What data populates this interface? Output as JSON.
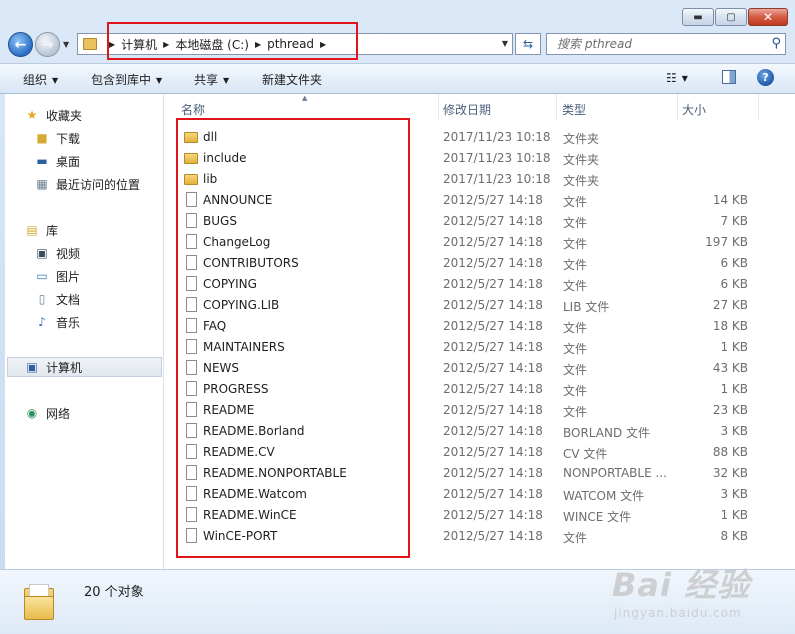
{
  "window": {
    "caption": {
      "minimize": "▬",
      "maximize": "▢",
      "close": "✕"
    }
  },
  "address": {
    "crumbs": [
      "计算机",
      "本地磁盘 (C:)",
      "pthread"
    ],
    "search_placeholder": "搜索 pthread"
  },
  "toolbar": {
    "organize": "组织",
    "include_in_library": "包含到库中",
    "share": "共享",
    "new_folder": "新建文件夹"
  },
  "nav": {
    "favorites": {
      "label": "收藏夹",
      "items": [
        "下载",
        "桌面",
        "最近访问的位置"
      ]
    },
    "libraries": {
      "label": "库",
      "items": [
        "视频",
        "图片",
        "文档",
        "音乐"
      ]
    },
    "computer": "计算机",
    "network": "网络"
  },
  "columns": {
    "name": "名称",
    "date": "修改日期",
    "type": "类型",
    "size": "大小"
  },
  "files": [
    {
      "name": "dll",
      "date": "2017/11/23 10:18",
      "type": "文件夹",
      "size": "",
      "kind": "folder"
    },
    {
      "name": "include",
      "date": "2017/11/23 10:18",
      "type": "文件夹",
      "size": "",
      "kind": "folder"
    },
    {
      "name": "lib",
      "date": "2017/11/23 10:18",
      "type": "文件夹",
      "size": "",
      "kind": "folder"
    },
    {
      "name": "ANNOUNCE",
      "date": "2012/5/27 14:18",
      "type": "文件",
      "size": "14 KB",
      "kind": "file"
    },
    {
      "name": "BUGS",
      "date": "2012/5/27 14:18",
      "type": "文件",
      "size": "7 KB",
      "kind": "file"
    },
    {
      "name": "ChangeLog",
      "date": "2012/5/27 14:18",
      "type": "文件",
      "size": "197 KB",
      "kind": "file"
    },
    {
      "name": "CONTRIBUTORS",
      "date": "2012/5/27 14:18",
      "type": "文件",
      "size": "6 KB",
      "kind": "file"
    },
    {
      "name": "COPYING",
      "date": "2012/5/27 14:18",
      "type": "文件",
      "size": "6 KB",
      "kind": "file"
    },
    {
      "name": "COPYING.LIB",
      "date": "2012/5/27 14:18",
      "type": "LIB 文件",
      "size": "27 KB",
      "kind": "file"
    },
    {
      "name": "FAQ",
      "date": "2012/5/27 14:18",
      "type": "文件",
      "size": "18 KB",
      "kind": "file"
    },
    {
      "name": "MAINTAINERS",
      "date": "2012/5/27 14:18",
      "type": "文件",
      "size": "1 KB",
      "kind": "file"
    },
    {
      "name": "NEWS",
      "date": "2012/5/27 14:18",
      "type": "文件",
      "size": "43 KB",
      "kind": "file"
    },
    {
      "name": "PROGRESS",
      "date": "2012/5/27 14:18",
      "type": "文件",
      "size": "1 KB",
      "kind": "file"
    },
    {
      "name": "README",
      "date": "2012/5/27 14:18",
      "type": "文件",
      "size": "23 KB",
      "kind": "file"
    },
    {
      "name": "README.Borland",
      "date": "2012/5/27 14:18",
      "type": "BORLAND 文件",
      "size": "3 KB",
      "kind": "file"
    },
    {
      "name": "README.CV",
      "date": "2012/5/27 14:18",
      "type": "CV 文件",
      "size": "88 KB",
      "kind": "file"
    },
    {
      "name": "README.NONPORTABLE",
      "date": "2012/5/27 14:18",
      "type": "NONPORTABLE ...",
      "size": "32 KB",
      "kind": "file"
    },
    {
      "name": "README.Watcom",
      "date": "2012/5/27 14:18",
      "type": "WATCOM 文件",
      "size": "3 KB",
      "kind": "file"
    },
    {
      "name": "README.WinCE",
      "date": "2012/5/27 14:18",
      "type": "WINCE 文件",
      "size": "1 KB",
      "kind": "file"
    },
    {
      "name": "WinCE-PORT",
      "date": "2012/5/27 14:18",
      "type": "文件",
      "size": "8 KB",
      "kind": "file"
    }
  ],
  "status": {
    "count": "20 个对象"
  },
  "watermark": {
    "main": "Bai 经验",
    "sub": "jingyan.baidu.com"
  },
  "colors": {
    "highlight": "#e0141c",
    "folder": "#e8c35e"
  }
}
